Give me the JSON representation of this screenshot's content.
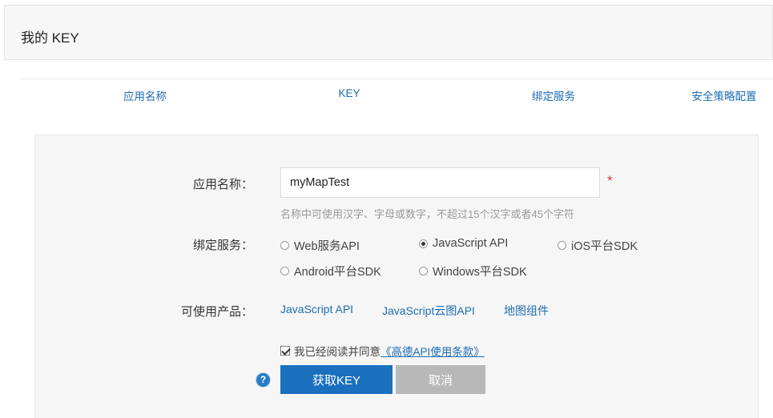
{
  "header": {
    "title": "我的 KEY"
  },
  "columns": [
    {
      "label": "应用名称"
    },
    {
      "label": "KEY"
    },
    {
      "label": "绑定服务"
    },
    {
      "label": "安全策略配置"
    }
  ],
  "form": {
    "app_name": {
      "label": "应用名称：",
      "value": "myMapTest",
      "required_mark": "*",
      "hint": "名称中可使用汉字、字母或数字，不超过15个汉字或者45个字符"
    },
    "services": {
      "label": "绑定服务：",
      "selected": "JavaScript API",
      "options": [
        "Web服务API",
        "JavaScript API",
        "iOS平台SDK",
        "Android平台SDK",
        "Windows平台SDK"
      ]
    },
    "products": {
      "label": "可使用产品：",
      "items": [
        "JavaScript API",
        "JavaScript云图API",
        "地图组件"
      ]
    },
    "agreement": {
      "checked": true,
      "text": "我已经阅读并同意",
      "link": "《高德API使用条款》"
    },
    "help_icon": "question-icon",
    "submit_label": "获取KEY",
    "cancel_label": "取消"
  },
  "colors": {
    "link": "#1e6db3",
    "primary_button": "#1a70be",
    "cancel_button": "#b8b8b8",
    "required": "#e0322f"
  }
}
